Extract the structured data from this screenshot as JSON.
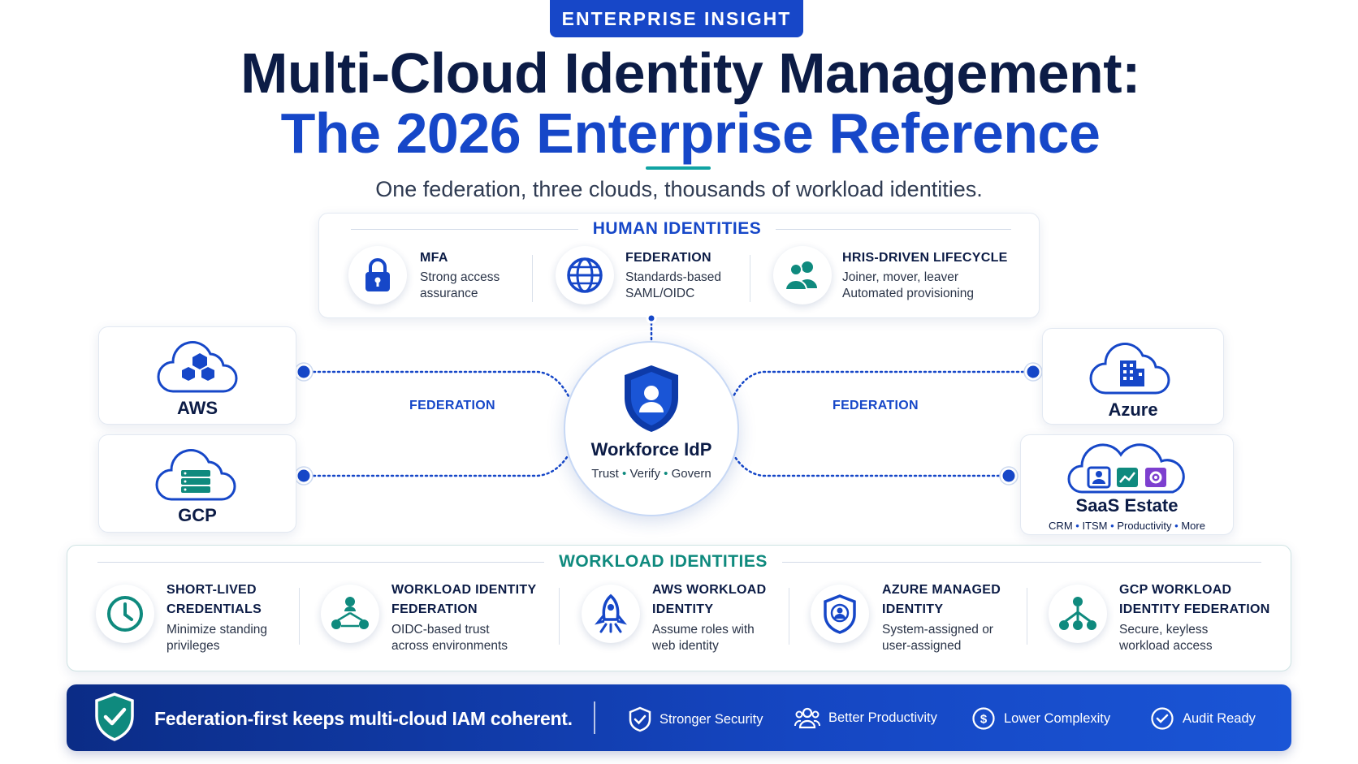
{
  "badge": "ENTERPRISE INSIGHT",
  "title": {
    "line1": "Multi-Cloud Identity Management:",
    "line2": "The 2026 Enterprise Reference"
  },
  "subtitle": "One federation, three clouds, thousands of workload identities.",
  "human": {
    "heading": "HUMAN IDENTITIES",
    "items": [
      {
        "title": "MFA",
        "desc1": "Strong access",
        "desc2": "assurance",
        "icon": "lock-icon"
      },
      {
        "title": "FEDERATION",
        "desc1": "Standards-based",
        "desc2": "SAML/OIDC",
        "icon": "globe-icon"
      },
      {
        "title": "HRIS-DRIVEN LIFECYCLE",
        "desc1": "Joiner, mover, leaver",
        "desc2": "Automated provisioning",
        "icon": "users-icon"
      }
    ]
  },
  "clouds": {
    "aws": "AWS",
    "gcp": "GCP",
    "azure": "Azure",
    "saas": {
      "title": "SaaS Estate",
      "tags": [
        "CRM",
        "ITSM",
        "Productivity",
        "More"
      ]
    }
  },
  "federation_label": "FEDERATION",
  "hub": {
    "title": "Workforce IdP",
    "tags": [
      "Trust",
      "Verify",
      "Govern"
    ]
  },
  "workload": {
    "heading": "WORKLOAD IDENTITIES",
    "items": [
      {
        "title1": "SHORT-LIVED",
        "title2": "CREDENTIALS",
        "desc1": "Minimize standing",
        "desc2": "privileges",
        "icon": "clock-icon"
      },
      {
        "title1": "WORKLOAD IDENTITY",
        "title2": "FEDERATION",
        "desc1": "OIDC-based trust",
        "desc2": "across environments",
        "icon": "network-icon"
      },
      {
        "title1": "AWS WORKLOAD",
        "title2": "IDENTITY",
        "desc1": "Assume roles with",
        "desc2": "web identity",
        "icon": "rocket-icon"
      },
      {
        "title1": "AZURE MANAGED",
        "title2": "IDENTITY",
        "desc1": "System-assigned or",
        "desc2": "user-assigned",
        "icon": "shield-user-icon"
      },
      {
        "title1": "GCP WORKLOAD",
        "title2": "IDENTITY FEDERATION",
        "desc1": "Secure, keyless",
        "desc2": "workload access",
        "icon": "hierarchy-icon"
      }
    ]
  },
  "footer": {
    "main": "Federation-first keeps multi-cloud IAM coherent.",
    "items": [
      "Stronger Security",
      "Better Productivity",
      "Lower Complexity",
      "Audit Ready"
    ]
  },
  "colors": {
    "navy": "#0c1c46",
    "blue": "#1647c8",
    "teal": "#0f8a7e",
    "footer": "#1546c2"
  }
}
